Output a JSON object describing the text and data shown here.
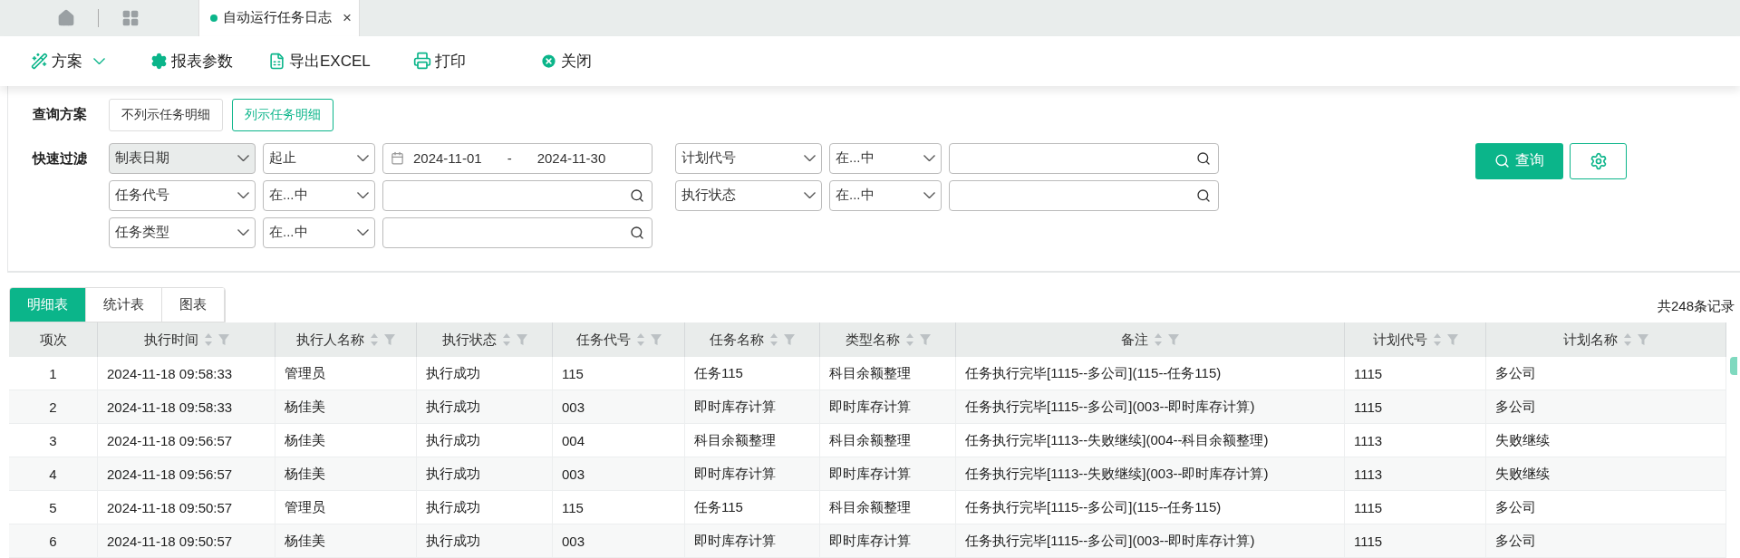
{
  "tab_bar": {
    "open_tab": {
      "label": "自动运行任务日志",
      "selected": true,
      "close": "×"
    }
  },
  "toolbar": [
    {
      "kind": "menu",
      "label": "方案"
    },
    {
      "kind": "button",
      "label": "报表参数"
    },
    {
      "kind": "button",
      "label": "导出EXCEL"
    },
    {
      "kind": "button",
      "label": "打印"
    },
    {
      "kind": "button",
      "label": "关闭"
    }
  ],
  "query_plan": {
    "label": "查询方案",
    "options": [
      {
        "label": "不列示任务明细",
        "selected": false
      },
      {
        "label": "列示任务明细",
        "selected": true
      }
    ]
  },
  "quick_filter": {
    "label": "快速过滤",
    "rows": [
      [
        {
          "kind": "date",
          "field": "制表日期",
          "field_selected": true,
          "operator": "起止",
          "start": "2024-11-01",
          "separator": "-",
          "end": "2024-11-30"
        },
        {
          "kind": "search",
          "field": "计划代号",
          "field_selected": false,
          "operator": "在...中"
        }
      ],
      [
        {
          "kind": "search",
          "field": "任务代号",
          "field_selected": false,
          "operator": "在...中"
        },
        {
          "kind": "search",
          "field": "执行状态",
          "field_selected": false,
          "operator": "在...中"
        }
      ],
      [
        {
          "kind": "search",
          "field": "任务类型",
          "field_selected": false,
          "operator": "在...中"
        }
      ]
    ]
  },
  "query_button": {
    "label": "查询"
  },
  "view_tabs": [
    {
      "label": "明细表",
      "selected": true
    },
    {
      "label": "统计表",
      "selected": false
    },
    {
      "label": "图表",
      "selected": false
    }
  ],
  "record_count": "共248条记录",
  "table": {
    "columns": [
      {
        "label": "项次",
        "sortable": false
      },
      {
        "label": "执行时间",
        "sortable": true
      },
      {
        "label": "执行人名称",
        "sortable": true
      },
      {
        "label": "执行状态",
        "sortable": true
      },
      {
        "label": "任务代号",
        "sortable": true
      },
      {
        "label": "任务名称",
        "sortable": true
      },
      {
        "label": "类型名称",
        "sortable": true
      },
      {
        "label": "备注",
        "sortable": true
      },
      {
        "label": "计划代号",
        "sortable": true
      },
      {
        "label": "计划名称",
        "sortable": true
      }
    ],
    "rows": [
      [
        "1",
        "2024-11-18 09:58:33",
        "管理员",
        "执行成功",
        "115",
        "任务115",
        "科目余额整理",
        "任务执行完毕[1115--多公司](115--任务115)",
        "1115",
        "多公司"
      ],
      [
        "2",
        "2024-11-18 09:58:33",
        "杨佳美",
        "执行成功",
        "003",
        "即时库存计算",
        "即时库存计算",
        "任务执行完毕[1115--多公司](003--即时库存计算)",
        "1115",
        "多公司"
      ],
      [
        "3",
        "2024-11-18 09:56:57",
        "杨佳美",
        "执行成功",
        "004",
        "科目余额整理",
        "科目余额整理",
        "任务执行完毕[1113--失败继续](004--科目余额整理)",
        "1113",
        "失败继续"
      ],
      [
        "4",
        "2024-11-18 09:56:57",
        "杨佳美",
        "执行成功",
        "003",
        "即时库存计算",
        "即时库存计算",
        "任务执行完毕[1113--失败继续](003--即时库存计算)",
        "1113",
        "失败继续"
      ],
      [
        "5",
        "2024-11-18 09:50:57",
        "管理员",
        "执行成功",
        "115",
        "任务115",
        "科目余额整理",
        "任务执行完毕[1115--多公司](115--任务115)",
        "1115",
        "多公司"
      ],
      [
        "6",
        "2024-11-18 09:50:57",
        "杨佳美",
        "执行成功",
        "003",
        "即时库存计算",
        "即时库存计算",
        "任务执行完毕[1115--多公司](003--即时库存计算)",
        "1115",
        "多公司"
      ]
    ]
  }
}
